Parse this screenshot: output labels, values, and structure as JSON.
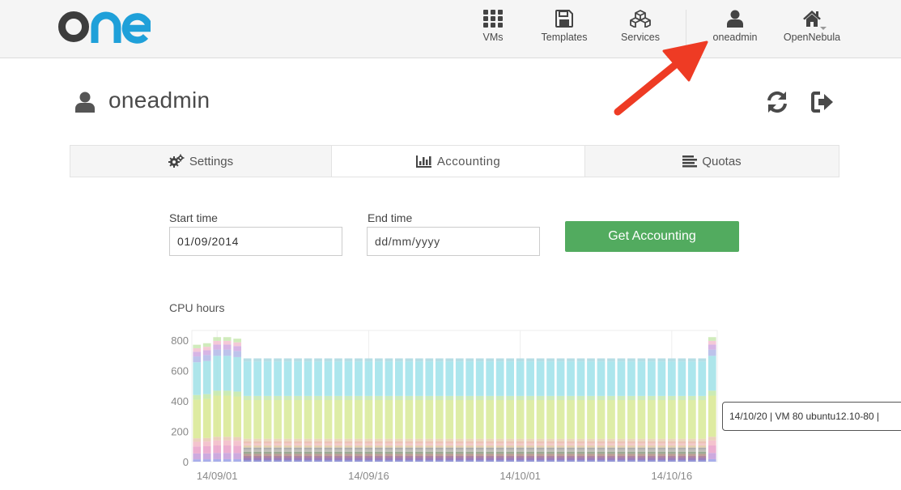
{
  "brand": {
    "logo_text": "one",
    "accent": "#1fa0d9",
    "dark": "#3d3d3d"
  },
  "nav": {
    "vms": "VMs",
    "templates": "Templates",
    "services": "Services",
    "user": "oneadmin",
    "zone": "OpenNebula"
  },
  "page": {
    "title": "oneadmin"
  },
  "tabs": [
    {
      "label": "Settings",
      "icon": "gears-icon"
    },
    {
      "label": "Accounting",
      "icon": "bar-chart-icon",
      "active": true
    },
    {
      "label": "Quotas",
      "icon": "list-icon"
    }
  ],
  "form": {
    "start_label": "Start time",
    "start_value": "01/09/2014",
    "end_label": "End time",
    "end_placeholder": "dd/mm/yyyy",
    "submit_label": "Get Accounting",
    "submit_color": "#52ab5f"
  },
  "chart_title": "CPU hours",
  "chart_data": {
    "type": "bar",
    "stacked": true,
    "title": "CPU hours",
    "ylim": [
      0,
      800
    ],
    "yticks": [
      0,
      200,
      400,
      600,
      800
    ],
    "xticks": [
      "14/09/01",
      "14/09/16",
      "14/10/01",
      "14/10/16"
    ],
    "dates": [
      "14/08/30",
      "14/08/31",
      "14/09/01",
      "14/09/02",
      "14/09/03",
      "14/09/04",
      "14/09/05",
      "14/09/06",
      "14/09/07",
      "14/09/08",
      "14/09/09",
      "14/09/10",
      "14/09/11",
      "14/09/12",
      "14/09/13",
      "14/09/14",
      "14/09/15",
      "14/09/16",
      "14/09/17",
      "14/09/18",
      "14/09/19",
      "14/09/20",
      "14/09/21",
      "14/09/22",
      "14/09/23",
      "14/09/24",
      "14/09/25",
      "14/09/26",
      "14/09/27",
      "14/09/28",
      "14/09/29",
      "14/09/30",
      "14/10/01",
      "14/10/02",
      "14/10/03",
      "14/10/04",
      "14/10/05",
      "14/10/06",
      "14/10/07",
      "14/10/08",
      "14/10/09",
      "14/10/10",
      "14/10/11",
      "14/10/12",
      "14/10/13",
      "14/10/14",
      "14/10/15",
      "14/10/16",
      "14/10/17",
      "14/10/18",
      "14/10/19",
      "14/10/20"
    ],
    "totals": [
      770,
      780,
      820,
      820,
      810,
      680,
      680,
      680,
      680,
      680,
      680,
      680,
      680,
      680,
      680,
      680,
      680,
      680,
      680,
      680,
      680,
      680,
      680,
      680,
      680,
      680,
      680,
      680,
      680,
      680,
      680,
      680,
      680,
      680,
      680,
      680,
      680,
      680,
      680,
      680,
      680,
      680,
      680,
      680,
      680,
      680,
      680,
      680,
      680,
      680,
      680,
      820
    ],
    "grid": true,
    "legend": "none"
  },
  "tooltip": "14/10/20 | VM 80 ubuntu12.10-80 |"
}
